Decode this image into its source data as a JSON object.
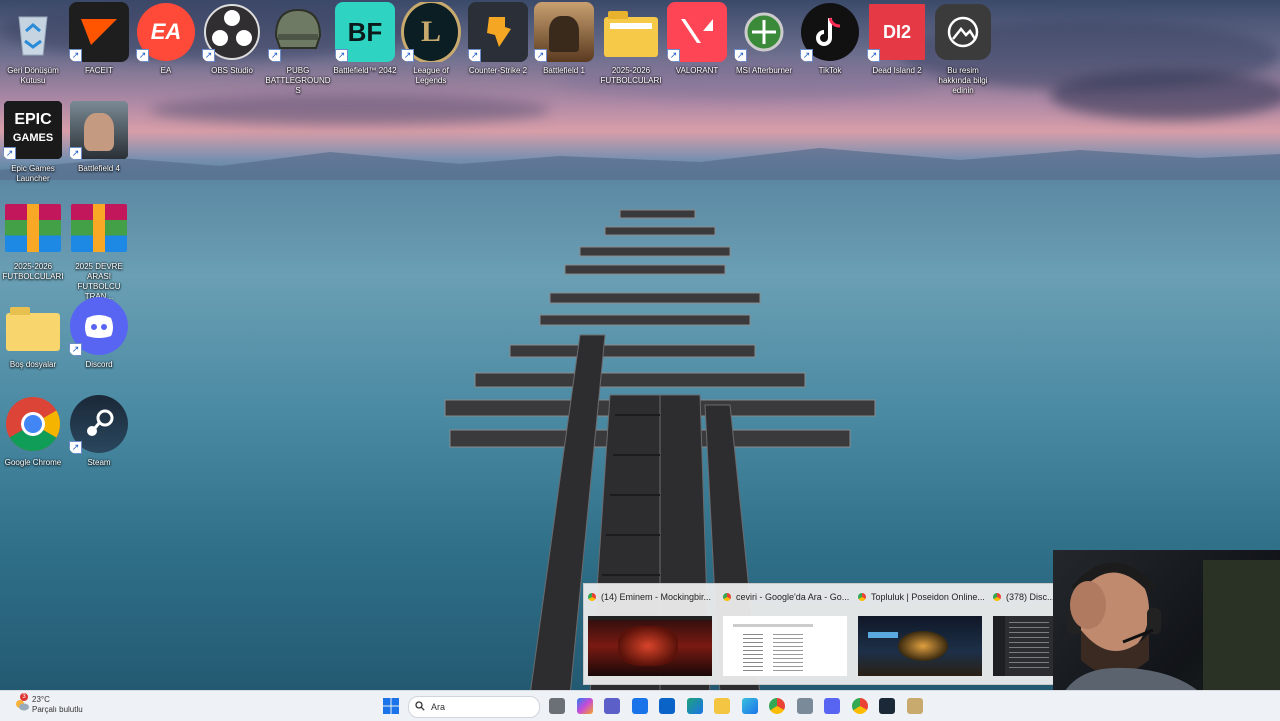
{
  "desktop_icons": [
    {
      "id": "recycle",
      "label": "Geri Dönüşüm Kutusu",
      "shortcut": false
    },
    {
      "id": "faceit",
      "label": "FACEIT",
      "shortcut": true
    },
    {
      "id": "ea",
      "label": "EA",
      "shortcut": true
    },
    {
      "id": "obs",
      "label": "OBS Studio",
      "shortcut": true
    },
    {
      "id": "pubg",
      "label": "PUBG BATTLEGROUNDS",
      "shortcut": true
    },
    {
      "id": "bf2042",
      "label": "Battlefield™ 2042",
      "shortcut": true
    },
    {
      "id": "lol",
      "label": "League of Legends",
      "shortcut": true
    },
    {
      "id": "cs2",
      "label": "Counter-Strike 2",
      "shortcut": true
    },
    {
      "id": "bf1",
      "label": "Battlefield 1",
      "shortcut": true
    },
    {
      "id": "folder-futbol",
      "label": "2025-2026 FUTBOLCULARI",
      "shortcut": false
    },
    {
      "id": "valorant",
      "label": "VALORANT",
      "shortcut": true
    },
    {
      "id": "afterburner",
      "label": "MSI Afterburner",
      "shortcut": true
    },
    {
      "id": "tiktok",
      "label": "TikTok",
      "shortcut": true
    },
    {
      "id": "deadisland",
      "label": "Dead Island 2",
      "shortcut": true
    },
    {
      "id": "unknown",
      "label": "Bu resim hakkında bilgi edinin",
      "shortcut": false
    },
    {
      "id": "epic",
      "label": "Epic Games Launcher",
      "shortcut": true
    },
    {
      "id": "bf4",
      "label": "Battlefield 4",
      "shortcut": true
    },
    {
      "id": "rar1",
      "label": "2025-2026 FUTBOLCULARI",
      "shortcut": false
    },
    {
      "id": "rar2",
      "label": "2025 DEVRE ARASI FUTBOLCU TRAN...",
      "shortcut": false
    },
    {
      "id": "bos",
      "label": "Boş dosyalar",
      "shortcut": false
    },
    {
      "id": "discord",
      "label": "Discord",
      "shortcut": true
    },
    {
      "id": "chrome",
      "label": "Google Chrome",
      "shortcut": false
    },
    {
      "id": "steam",
      "label": "Steam",
      "shortcut": true
    }
  ],
  "previews": [
    {
      "title": "(14) Eminem - Mockingbir..."
    },
    {
      "title": "ceviri - Google'da Ara - Go..."
    },
    {
      "title": "Topluluk | Poseidon Online..."
    },
    {
      "title": "(378) Disc..."
    }
  ],
  "taskbar": {
    "weather_temp": "23°C",
    "weather_desc": "Parçalı bulutlu",
    "weather_badge": "3",
    "search_placeholder": "Ara",
    "apps": [
      "files-icon",
      "copilot-icon",
      "teams-icon",
      "store-icon",
      "outlook-icon",
      "edge-icon",
      "explorer-icon",
      "edge-icon-2",
      "chrome-icon",
      "settings-icon",
      "discord-icon",
      "chrome-icon-2",
      "steam-icon",
      "lol-icon"
    ]
  }
}
